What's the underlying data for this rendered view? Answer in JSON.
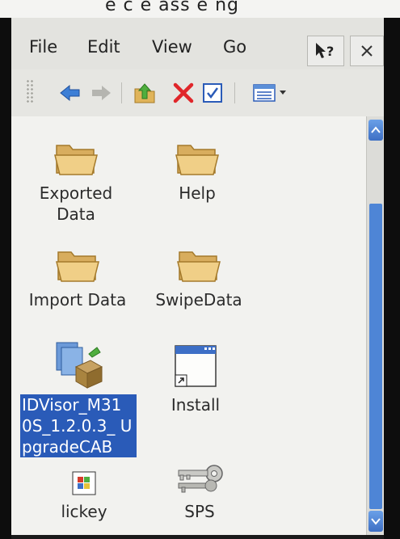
{
  "header_snippet": "e c e ass e ng",
  "menu": {
    "file": "File",
    "edit": "Edit",
    "view": "View",
    "go": "Go"
  },
  "files": [
    {
      "name": "Exported Data",
      "icon": "folder-icon"
    },
    {
      "name": "Help",
      "icon": "folder-icon"
    },
    {
      "name": "Import Data",
      "icon": "folder-icon"
    },
    {
      "name": "SwipeData",
      "icon": "folder-icon"
    },
    {
      "name": "IDVisor_M31 0S_1.2.0.3_ UpgradeCAB",
      "icon": "cab-package-icon",
      "selected": true
    },
    {
      "name": "Install",
      "icon": "shortcut-window-icon"
    },
    {
      "name": "lickey",
      "icon": "app-icon"
    },
    {
      "name": "SPS",
      "icon": "keys-icon"
    }
  ],
  "colors": {
    "selection": "#2a5bb8",
    "scrollbar": "#4e85d6",
    "folder": "#e6c27a"
  }
}
